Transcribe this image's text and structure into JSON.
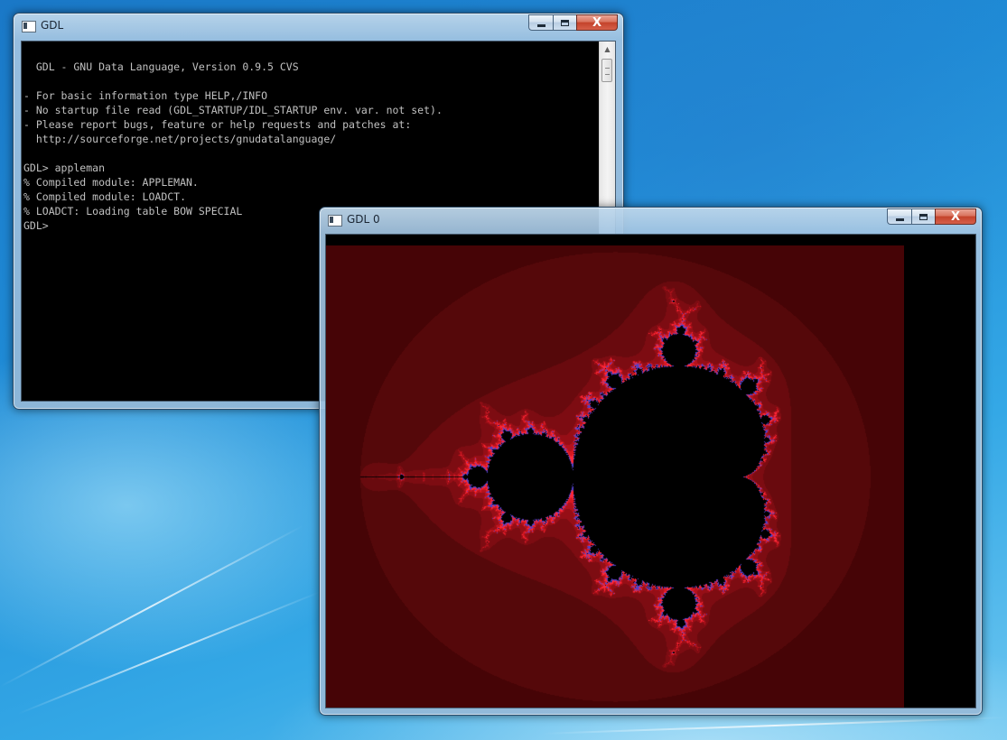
{
  "desktop": {},
  "console_window": {
    "title": "GDL",
    "buttons": {
      "minimize": "minimize",
      "maximize": "maximize",
      "close": "X"
    },
    "lines": [
      "",
      "  GDL - GNU Data Language, Version 0.9.5 CVS",
      "",
      "- For basic information type HELP,/INFO",
      "- No startup file read (GDL_STARTUP/IDL_STARTUP env. var. not set).",
      "- Please report bugs, feature or help requests and patches at:",
      "  http://sourceforge.net/projects/gnudatalanguage/",
      "",
      "GDL> appleman",
      "% Compiled module: APPLEMAN.",
      "% Compiled module: LOADCT.",
      "% LOADCT: Loading table BOW SPECIAL",
      "GDL>"
    ]
  },
  "plot_window": {
    "title": "GDL 0",
    "buttons": {
      "minimize": "minimize",
      "maximize": "maximize",
      "close": "X"
    },
    "image": {
      "type": "mandelbrot",
      "center_x": -0.5,
      "center_y": 0.0,
      "span_x": 3.4,
      "colors": {
        "set": "#000000",
        "background": "#3a0000",
        "band_dark": "#5a0a0e",
        "band_mid": "#a0141e",
        "band_bright": "#ff2838",
        "edge": "#5040c0"
      }
    }
  }
}
